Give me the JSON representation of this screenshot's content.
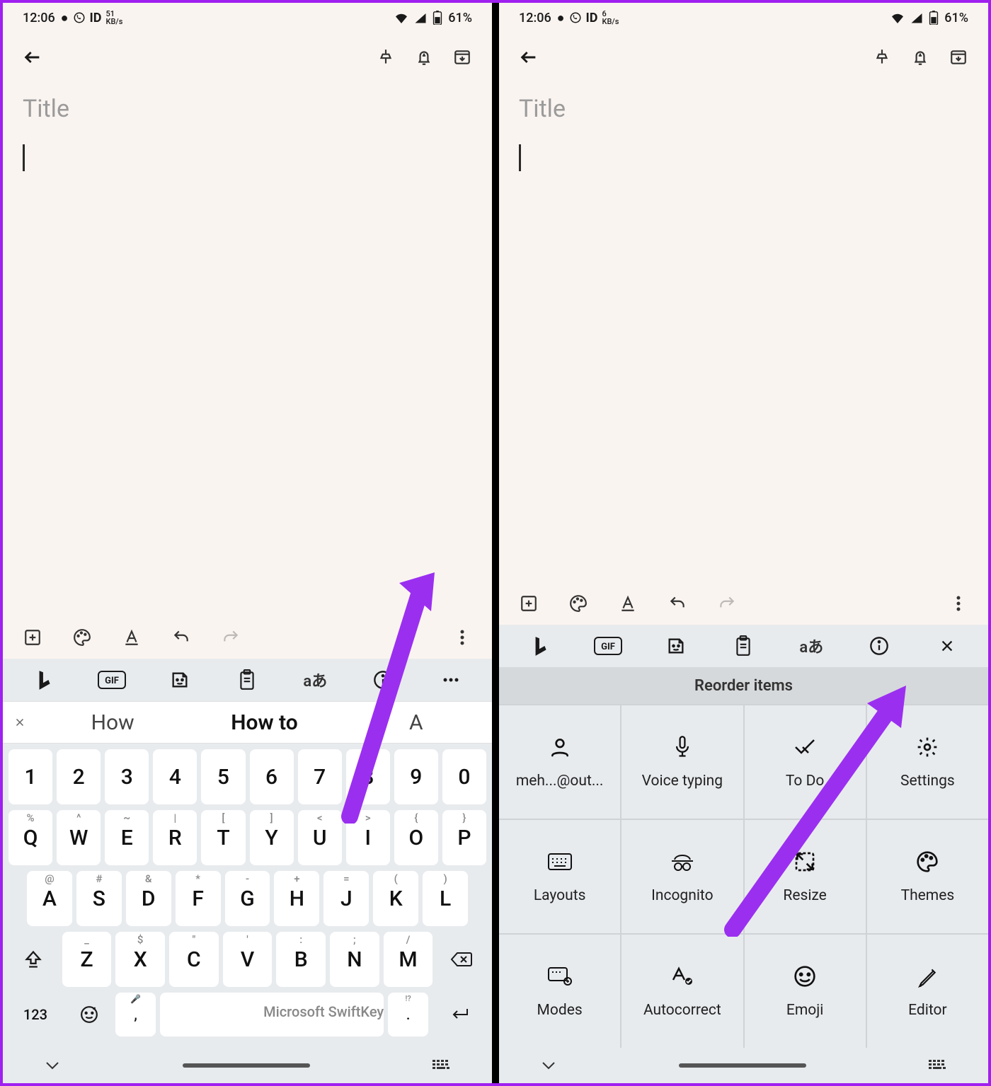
{
  "status": {
    "time": "12:06",
    "kbps_left": "51",
    "kbps_right": "6",
    "kbps_unit": "KB/s",
    "battery": "61%"
  },
  "note": {
    "title_placeholder": "Title"
  },
  "suggestions": {
    "s1": "How",
    "s2": "How to",
    "s3": "A"
  },
  "keyboard": {
    "row1": [
      {
        "main": "1",
        "hint": ""
      },
      {
        "main": "2",
        "hint": ""
      },
      {
        "main": "3",
        "hint": ""
      },
      {
        "main": "4",
        "hint": ""
      },
      {
        "main": "5",
        "hint": ""
      },
      {
        "main": "6",
        "hint": ""
      },
      {
        "main": "7",
        "hint": ""
      },
      {
        "main": "8",
        "hint": ""
      },
      {
        "main": "9",
        "hint": ""
      },
      {
        "main": "0",
        "hint": ""
      }
    ],
    "row2": [
      {
        "main": "Q",
        "hint": "%"
      },
      {
        "main": "W",
        "hint": "^"
      },
      {
        "main": "E",
        "hint": "~"
      },
      {
        "main": "R",
        "hint": "|"
      },
      {
        "main": "T",
        "hint": "["
      },
      {
        "main": "Y",
        "hint": "]"
      },
      {
        "main": "U",
        "hint": "<"
      },
      {
        "main": "I",
        "hint": ">"
      },
      {
        "main": "O",
        "hint": "{"
      },
      {
        "main": "P",
        "hint": "}"
      }
    ],
    "row3": [
      {
        "main": "A",
        "hint": "@"
      },
      {
        "main": "S",
        "hint": "#"
      },
      {
        "main": "D",
        "hint": "&"
      },
      {
        "main": "F",
        "hint": "*"
      },
      {
        "main": "G",
        "hint": "-"
      },
      {
        "main": "H",
        "hint": "+"
      },
      {
        "main": "J",
        "hint": "="
      },
      {
        "main": "K",
        "hint": "("
      },
      {
        "main": "L",
        "hint": ")"
      }
    ],
    "row4": [
      {
        "main": "Z",
        "hint": "_"
      },
      {
        "main": "X",
        "hint": "$"
      },
      {
        "main": "C",
        "hint": "\""
      },
      {
        "main": "V",
        "hint": "'"
      },
      {
        "main": "B",
        "hint": ":"
      },
      {
        "main": "N",
        "hint": ";"
      },
      {
        "main": "M",
        "hint": "/"
      }
    ],
    "fn123": "123",
    "space_label": "Microsoft SwiftKey"
  },
  "reorder": {
    "header": "Reorder items",
    "tiles": [
      {
        "label": "meh...@out...",
        "icon": "account-icon"
      },
      {
        "label": "Voice typing",
        "icon": "mic-icon"
      },
      {
        "label": "To Do",
        "icon": "todo-icon"
      },
      {
        "label": "Settings",
        "icon": "gear-icon"
      },
      {
        "label": "Layouts",
        "icon": "keyboard-icon"
      },
      {
        "label": "Incognito",
        "icon": "incognito-icon"
      },
      {
        "label": "Resize",
        "icon": "resize-icon"
      },
      {
        "label": "Themes",
        "icon": "palette-icon"
      },
      {
        "label": "Modes",
        "icon": "modes-icon"
      },
      {
        "label": "Autocorrect",
        "icon": "autocorrect-icon"
      },
      {
        "label": "Emoji",
        "icon": "emoji-icon"
      },
      {
        "label": "Editor",
        "icon": "editor-icon"
      }
    ]
  }
}
